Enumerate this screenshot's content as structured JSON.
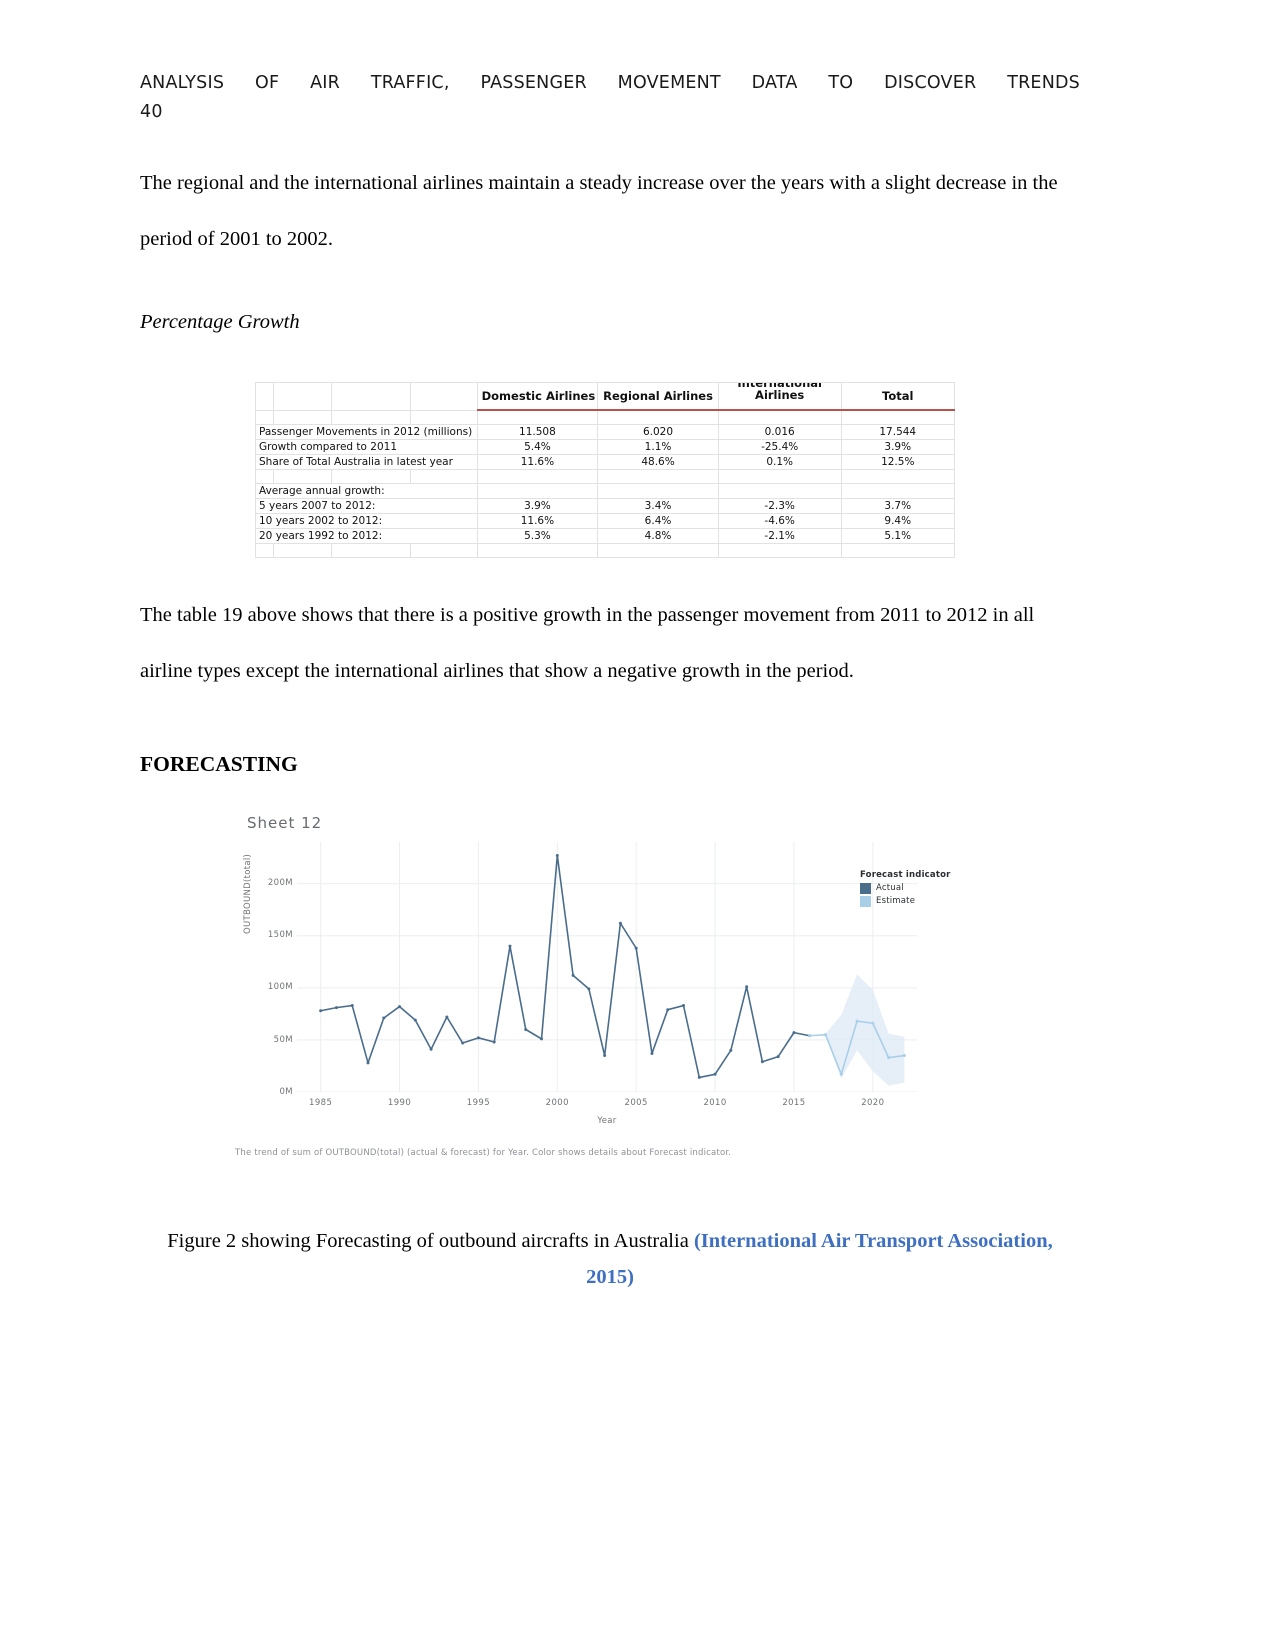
{
  "header": {
    "title_words": [
      "ANALYSIS",
      "OF",
      "AIR",
      "TRAFFIC,",
      "PASSENGER",
      "MOVEMENT",
      "DATA",
      "TO",
      "DISCOVER",
      "TRENDS"
    ],
    "page_number": "40"
  },
  "body": {
    "paragraph_1": "The regional and the international airlines maintain a steady increase over the years with a slight decrease in the period of 2001 to 2002.",
    "subhead": "Percentage Growth",
    "paragraph_2": "The table 19 above shows that there is a positive growth in the passenger movement from 2011 to 2012 in all airline types except the international airlines that show a negative growth in the period.",
    "section_heading": "FORECASTING"
  },
  "table": {
    "columns": [
      "Domestic Airlines",
      "Regional Airlines",
      "International Airlines",
      "Total"
    ],
    "international_header_line1": "International",
    "international_header_line2": "Airlines",
    "rows": [
      {
        "label": "Passenger Movements in 2012 (millions)",
        "values": [
          "11.508",
          "6.020",
          "0.016",
          "17.544"
        ]
      },
      {
        "label": "Growth compared to 2011",
        "values": [
          "5.4%",
          "1.1%",
          "-25.4%",
          "3.9%"
        ]
      },
      {
        "label": "Share of Total Australia in latest year",
        "values": [
          "11.6%",
          "48.6%",
          "0.1%",
          "12.5%"
        ]
      }
    ],
    "group_label": "Average annual growth:",
    "growth_rows": [
      {
        "label": "5 years 2007 to 2012:",
        "values": [
          "3.9%",
          "3.4%",
          "-2.3%",
          "3.7%"
        ]
      },
      {
        "label": "10 years 2002 to 2012:",
        "values": [
          "11.6%",
          "6.4%",
          "-4.6%",
          "9.4%"
        ]
      },
      {
        "label": "20 years 1992 to 2012:",
        "values": [
          "5.3%",
          "4.8%",
          "-2.1%",
          "5.1%"
        ]
      }
    ]
  },
  "chart_data": {
    "type": "line",
    "title": "Sheet 12",
    "xlabel": "Year",
    "ylabel": "OUTBOUND(total)",
    "xlim": [
      1983.5,
      2022.8
    ],
    "ylim": [
      0,
      240
    ],
    "xticks": [
      "1985",
      "1990",
      "1995",
      "2000",
      "2005",
      "2010",
      "2015",
      "2020"
    ],
    "xtick_values": [
      1985,
      1990,
      1995,
      2000,
      2005,
      2010,
      2015,
      2020
    ],
    "yticks": [
      "0M",
      "50M",
      "100M",
      "150M",
      "200M"
    ],
    "ytick_values": [
      0,
      50,
      100,
      150,
      200
    ],
    "grid": true,
    "units": "millions",
    "legend": {
      "title": "Forecast indicator",
      "position": "right",
      "entries": [
        {
          "label": "Actual",
          "color": "#4a6d8c"
        },
        {
          "label": "Estimate",
          "color": "#a9cfe8"
        }
      ]
    },
    "series": [
      {
        "name": "Actual",
        "color": "#4a6d8c",
        "x": [
          1985,
          1986,
          1987,
          1988,
          1989,
          1990,
          1991,
          1992,
          1993,
          1994,
          1995,
          1996,
          1997,
          1998,
          1999,
          2000,
          2001,
          2002,
          2003,
          2004,
          2005,
          2006,
          2007,
          2008,
          2009,
          2010,
          2011,
          2012,
          2013,
          2014,
          2015,
          2016
        ],
        "values": [
          78,
          81,
          83,
          28,
          71,
          82,
          69,
          41,
          72,
          47,
          52,
          48,
          140,
          60,
          51,
          227,
          112,
          99,
          35,
          162,
          138,
          37,
          79,
          83,
          14,
          17,
          40,
          101,
          29,
          34,
          57,
          54
        ]
      },
      {
        "name": "Estimate",
        "color": "#a9cfe8",
        "x": [
          2016,
          2017,
          2018,
          2019,
          2020,
          2021,
          2022
        ],
        "values": [
          54,
          55,
          17,
          68,
          66,
          33,
          35
        ]
      }
    ],
    "confidence_band": {
      "color": "#ddeaf4",
      "x": [
        2017,
        2018,
        2019,
        2020,
        2021,
        2022
      ],
      "upper": [
        56,
        74,
        113,
        98,
        56,
        53
      ],
      "lower": [
        54,
        13,
        40,
        20,
        6,
        9
      ]
    },
    "annotation": "The trend of sum of OUTBOUND(total) (actual & forecast) for Year.  Color shows details about Forecast indicator."
  },
  "figure_caption": {
    "text": "Figure 2 showing Forecasting of outbound aircrafts in Australia ",
    "citation": "(International Air Transport Association, 2015)"
  }
}
